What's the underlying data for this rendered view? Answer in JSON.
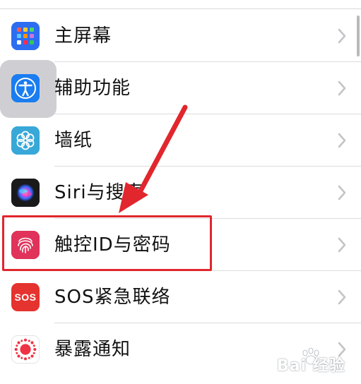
{
  "settings_list": {
    "items": [
      {
        "label": "主屏幕",
        "icon": "home-screen-icon",
        "color": "#2c6df1"
      },
      {
        "label": "辅助功能",
        "icon": "accessibility-icon",
        "color": "#1a7df0"
      },
      {
        "label": "墙纸",
        "icon": "wallpaper-icon",
        "color": "#38a8d8"
      },
      {
        "label": "Siri与搜索",
        "icon": "siri-icon",
        "color": "#222222"
      },
      {
        "label": "触控ID与密码",
        "icon": "fingerprint-icon",
        "color": "#e0325b"
      },
      {
        "label": "SOS紧急联络",
        "icon": "sos-icon",
        "color": "#e5332f",
        "icon_text": "SOS"
      },
      {
        "label": "暴露通知",
        "icon": "exposure-notification-icon",
        "color": "#ffffff"
      }
    ]
  },
  "annotation": {
    "highlight_color": "#e1262d",
    "arrow_color": "#e1262d"
  },
  "watermark": {
    "text": "Bai 经验"
  }
}
